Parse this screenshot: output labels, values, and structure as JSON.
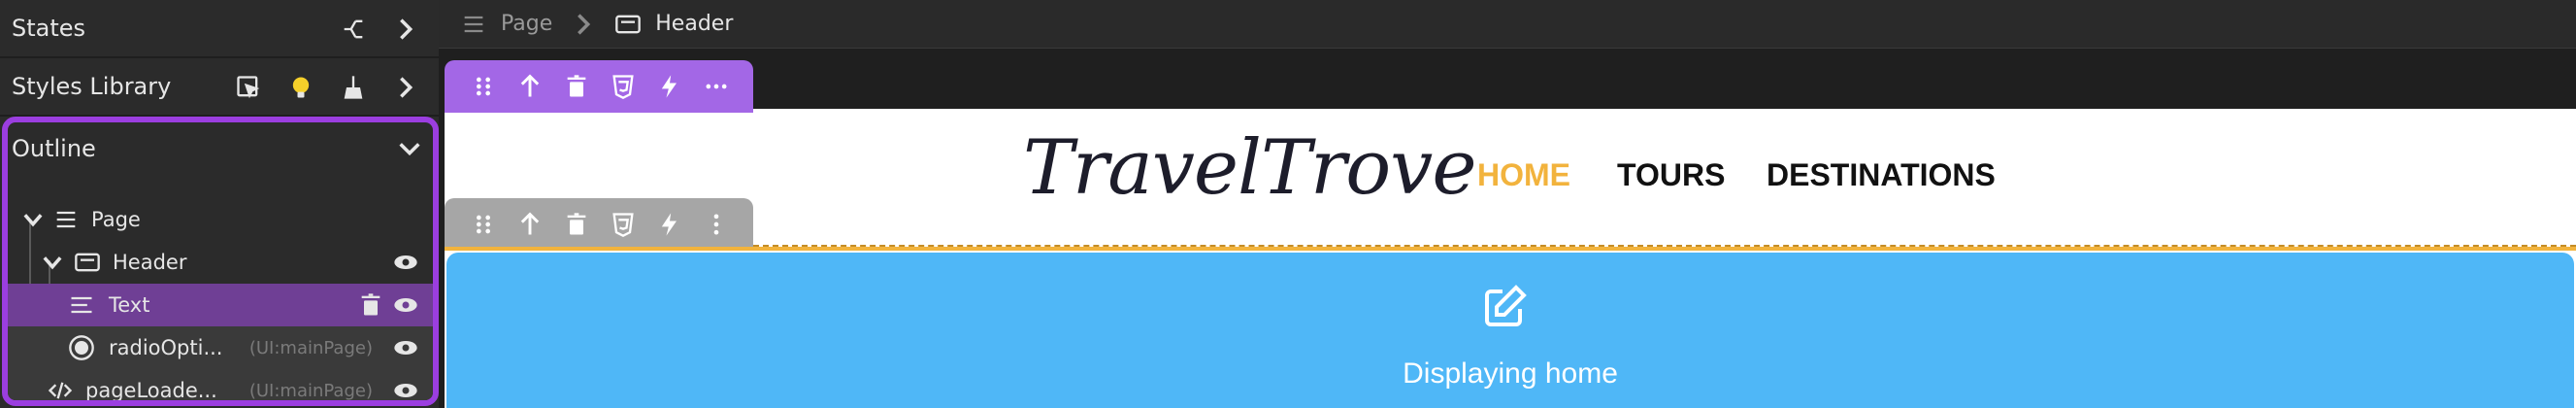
{
  "sidebar": {
    "states_label": "States",
    "styles_library_label": "Styles Library",
    "outline": {
      "label": "Outline",
      "items": [
        {
          "label": "Page",
          "meta": ""
        },
        {
          "label": "Header",
          "meta": ""
        },
        {
          "label": "Text",
          "meta": ""
        },
        {
          "label": "radioOpti...",
          "meta": "(UI:mainPage)"
        },
        {
          "label": "pageLoade...",
          "meta": "(UI:mainPage)"
        }
      ]
    },
    "icons": {
      "states": [
        "branch-icon",
        "chevron-right-icon"
      ],
      "styles": [
        "select-icon",
        "lightbulb-icon",
        "broom-icon",
        "chevron-right-icon"
      ]
    }
  },
  "breadcrumb": {
    "items": [
      {
        "label": "Page",
        "icon": "lines-icon"
      },
      {
        "label": "Header",
        "icon": "header-icon"
      }
    ]
  },
  "canvas": {
    "brand": "TravelTrove",
    "nav": [
      "HOME",
      "TOURS",
      "DESTINATIONS"
    ],
    "message": "Displaying home"
  },
  "colors": {
    "accent_purple": "#9b3ee0",
    "toolbar_purple": "#a367e6",
    "gold": "#f2b33d",
    "blue": "#4fb7f7"
  }
}
